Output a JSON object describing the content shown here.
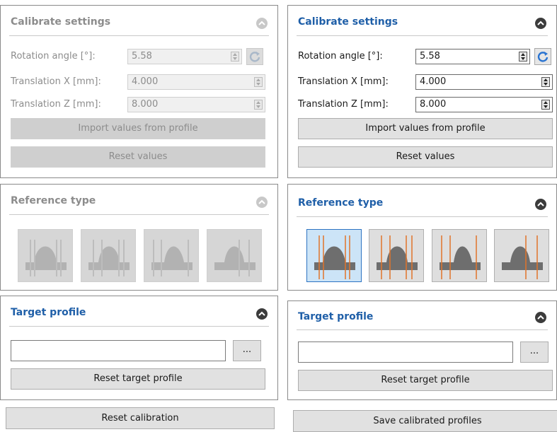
{
  "left": {
    "calibrate": {
      "title": "Calibrate settings",
      "rotation_label": "Rotation angle [°]:",
      "rotation_value": "5.58",
      "transx_label": "Translation X [mm]:",
      "transx_value": "4.000",
      "transz_label": "Translation Z [mm]:",
      "transz_value": "8.000",
      "import_label": "Import values from profile",
      "reset_values_label": "Reset values"
    },
    "reference": {
      "title": "Reference type"
    },
    "target": {
      "title": "Target profile",
      "profile_value": "",
      "browse_label": "...",
      "reset_label": "Reset target profile"
    },
    "bottom_button": "Reset calibration"
  },
  "right": {
    "calibrate": {
      "title": "Calibrate settings",
      "rotation_label": "Rotation angle [°]:",
      "rotation_value": "5.58",
      "transx_label": "Translation X [mm]:",
      "transx_value": "4.000",
      "transz_label": "Translation Z [mm]:",
      "transz_value": "8.000",
      "import_label": "Import values from profile",
      "reset_values_label": "Reset values"
    },
    "reference": {
      "title": "Reference type",
      "selected_index": 0
    },
    "target": {
      "title": "Target profile",
      "profile_value": "",
      "browse_label": "...",
      "reset_label": "Reset target profile"
    },
    "bottom_button": "Save calibrated profiles"
  },
  "colors": {
    "title_blue": "#1f5fa8",
    "disabled_text": "#8c8c8c",
    "selected_tile_border": "#2d73c2",
    "selected_tile_fill": "#cce4f7",
    "ref_line_orange": "#e0742a",
    "refresh_icon_blue": "#2a74d1"
  }
}
